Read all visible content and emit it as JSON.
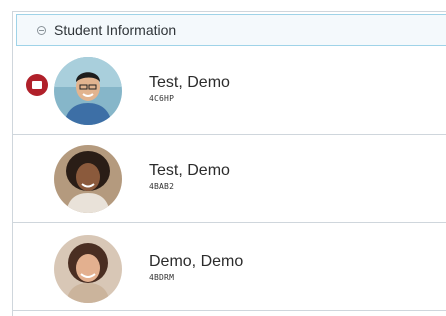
{
  "panel": {
    "title": "Student Information"
  },
  "students": [
    {
      "name": "Test, Demo",
      "id": "4C6HP",
      "has_message": true
    },
    {
      "name": "Test, Demo",
      "id": "4BAB2",
      "has_message": false
    },
    {
      "name": "Demo, Demo",
      "id": "4BDRM",
      "has_message": false
    }
  ],
  "colors": {
    "header_border": "#9fd3e8",
    "badge": "#b0202a"
  }
}
